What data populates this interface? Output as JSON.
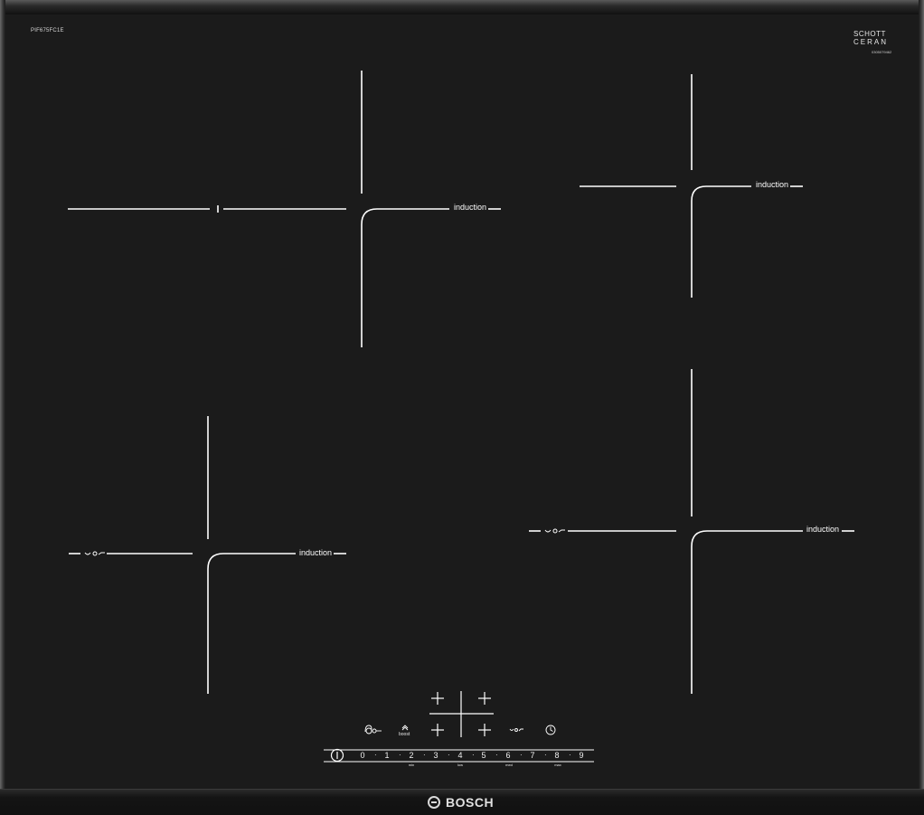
{
  "model_number": "PIF675FC1E",
  "glass_brand": {
    "line1": "SCHOTT",
    "line2": "CERAN",
    "code": "0305079462"
  },
  "zones": [
    {
      "id": "front-left",
      "label": "induction"
    },
    {
      "id": "rear-right",
      "label": "induction"
    },
    {
      "id": "rear-left",
      "label": "induction"
    },
    {
      "id": "front-right",
      "label": "induction"
    }
  ],
  "control_panel": {
    "boost_label": "boost",
    "scale": [
      "0",
      "1",
      "2",
      "3",
      "4",
      "5",
      "6",
      "7",
      "8",
      "9"
    ],
    "scale_sublabels": {
      "min": "min",
      "low": "low",
      "med": "med",
      "max": "max"
    }
  },
  "brand": "BOSCH",
  "icons": [
    "power-icon",
    "childlock-icon",
    "boost-icon",
    "zone-select-icon",
    "powermove-icon",
    "timer-icon",
    "bosch-logo-icon"
  ],
  "colors": {
    "glass": "#1b1b1b",
    "print": "#ffffff",
    "frame": "#3a3a3a"
  }
}
